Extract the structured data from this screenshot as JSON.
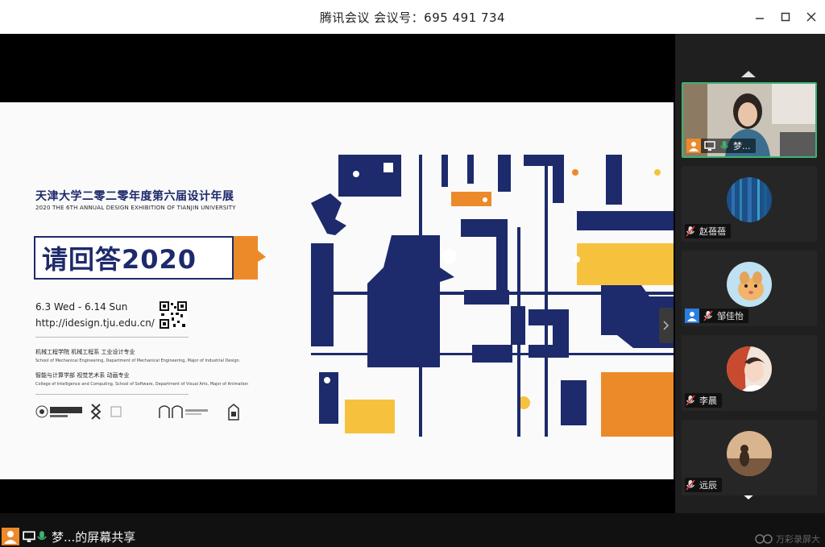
{
  "window": {
    "title": "腾讯会议  会议号：695 491 734",
    "minimize_glyph": "—",
    "maximize_glyph": "☐",
    "close_glyph": "✕"
  },
  "slide": {
    "title_cn": "天津大学二零二零年度第六届设计年展",
    "title_en": "2020 THE 6TH ANNUAL DESIGN EXHIBITION OF TIANJIN UNIVERSITY",
    "logo_text": "请回答2020",
    "date_range": "6.3 Wed - 6.14 Sun",
    "url": "http://idesign.tju.edu.cn/",
    "dept1_cn": "机械工程学院 机械工程系 工业设计专业",
    "dept1_en": "School of Mechanical Engineering, Department of Mechanical Engineering, Major of Industrial Design",
    "dept2_cn": "智能与计算学部 视觉艺术系 动画专业",
    "dept2_en": "College of Intelligence and Computing, School of Software, Department of Visual Arts, Major of Animation",
    "colors": {
      "navy": "#1d2a6b",
      "orange": "#ec8a2a",
      "yellow": "#f6c23e"
    }
  },
  "participants": [
    {
      "name": "梦...",
      "active": true
    },
    {
      "name": "赵蓓蓓"
    },
    {
      "name": "邹佳怡",
      "host": true
    },
    {
      "name": "李晨"
    },
    {
      "name": "远辰"
    }
  ],
  "status": {
    "share_text": "梦...的屏幕共享",
    "watermark": "万彩录屏大"
  },
  "icons": {
    "host": "person-icon",
    "screen": "screen-share-icon",
    "mic_on": "mic-on-icon",
    "mic_off": "mic-muted-icon",
    "scroll_up": "chevron-up-icon",
    "scroll_down": "chevron-down-icon"
  }
}
